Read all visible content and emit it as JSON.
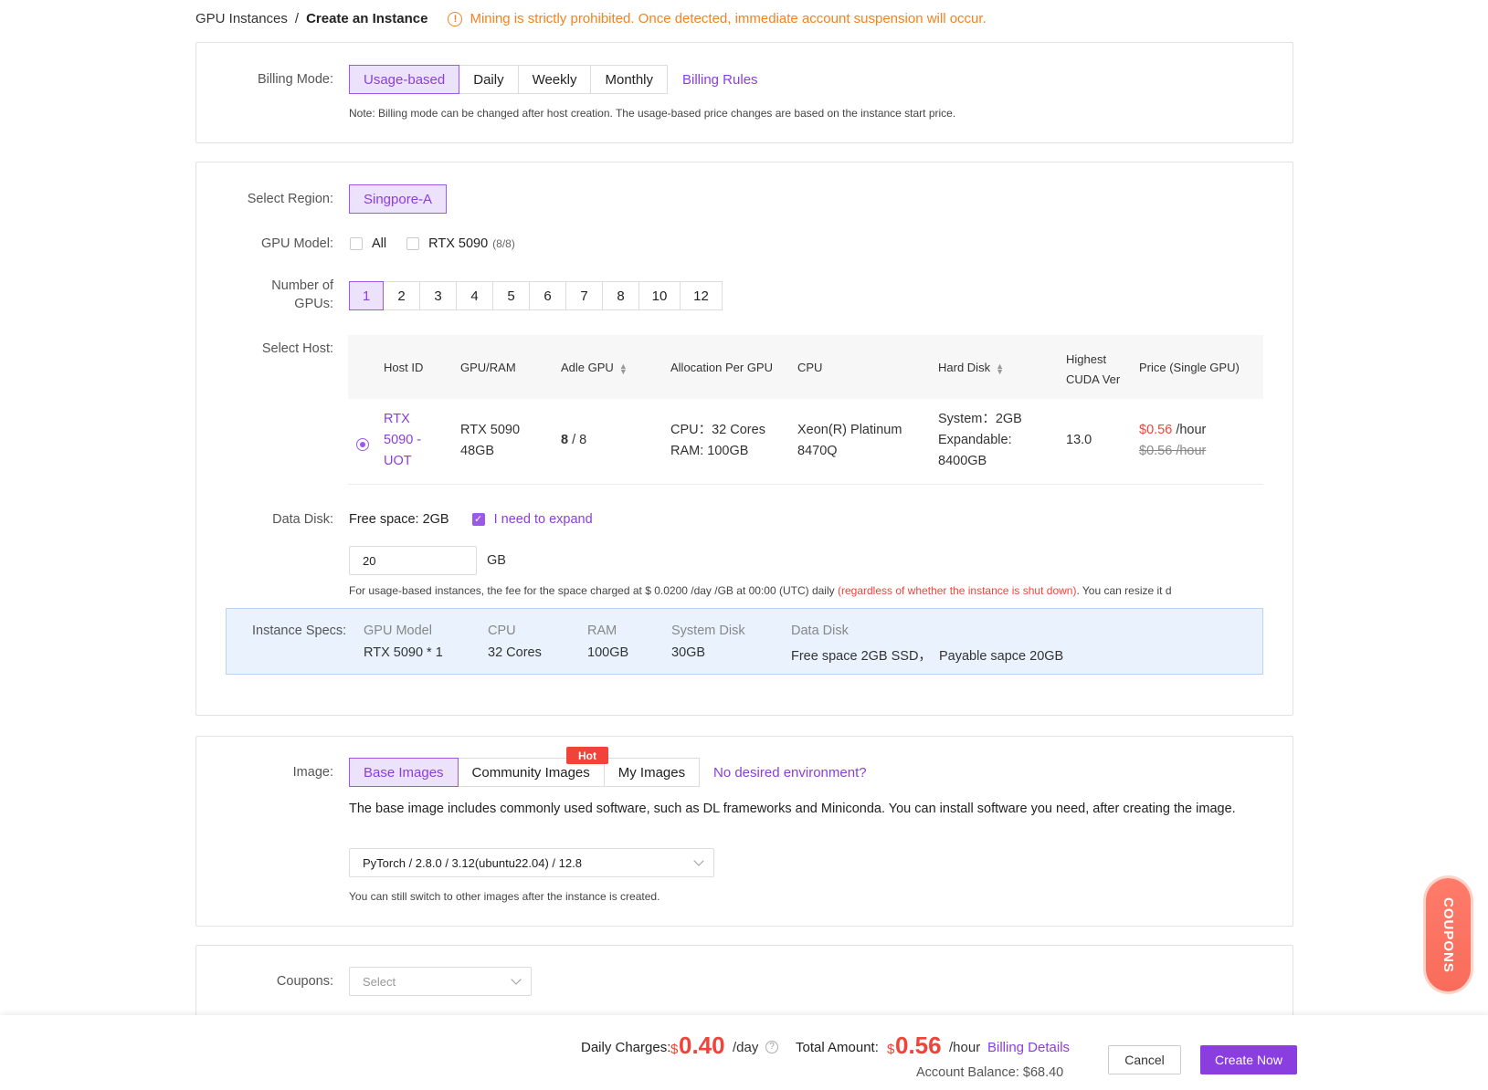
{
  "breadcrumb": {
    "parent": "GPU Instances",
    "separator": "/",
    "current": "Create an Instance"
  },
  "warning": {
    "icon": "info-icon",
    "text": "Mining is strictly prohibited. Once detected, immediate account suspension will occur."
  },
  "billing": {
    "label": "Billing Mode:",
    "options": [
      "Usage-based",
      "Daily",
      "Weekly",
      "Monthly"
    ],
    "selected": "Usage-based",
    "rules_link": "Billing Rules",
    "note": "Note: Billing mode can be changed after host creation. The usage-based price changes are based on the instance start price."
  },
  "region": {
    "label": "Select Region:",
    "selected": "Singpore-A"
  },
  "gpu_model": {
    "label": "GPU Model:",
    "options": [
      {
        "label": "All"
      },
      {
        "label": "RTX 5090",
        "count": "(8/8)"
      }
    ]
  },
  "gpu_count": {
    "label_line1": "Number of",
    "label_line2": "GPUs:",
    "options": [
      "1",
      "2",
      "3",
      "4",
      "5",
      "6",
      "7",
      "8",
      "10",
      "12"
    ],
    "selected": "1"
  },
  "host": {
    "label": "Select Host:",
    "headers": {
      "host_id": "Host ID",
      "gpu_ram": "GPU/RAM",
      "idle_gpu": "Adle GPU",
      "allocation": "Allocation Per GPU",
      "cpu": "CPU",
      "hard_disk": "Hard Disk",
      "cuda_line1": "Highest",
      "cuda_line2": "CUDA Ver",
      "price": "Price (Single GPU)"
    },
    "row": {
      "host_id_l1": "RTX",
      "host_id_l2": "5090 -",
      "host_id_l3": "UOT",
      "gpu_l1": "RTX 5090",
      "gpu_l2": "48GB",
      "idle_avail": "8",
      "idle_total": "/ 8",
      "alloc_l1": "CPU：32 Cores",
      "alloc_l2": "RAM: 100GB",
      "cpu_l1": "Xeon(R) Platinum",
      "cpu_l2": "8470Q",
      "disk_l1": "System：2GB",
      "disk_l2": "Expandable:",
      "disk_l3": "8400GB",
      "cuda": "13.0",
      "price": "$0.56",
      "price_unit": "/hour",
      "price_orig": "$0.56 /hour"
    }
  },
  "data_disk": {
    "label": "Data Disk:",
    "free_space": "Free space: 2GB",
    "expand_label": "I need to expand",
    "expand_checked": true,
    "value": "20",
    "unit": "GB",
    "note_a": "For usage-based instances, the fee for the space charged at $ 0.0200 /day /GB at 00:00 (UTC) daily ",
    "note_red": "(regardless of whether the instance is shut down)",
    "note_b": ". You can resize it d"
  },
  "specs": {
    "label": "Instance Specs:",
    "items": [
      {
        "head": "GPU Model",
        "value": "RTX 5090 * 1"
      },
      {
        "head": "CPU",
        "value": "32 Cores"
      },
      {
        "head": "RAM",
        "value": "100GB"
      },
      {
        "head": "System Disk",
        "value": "30GB"
      },
      {
        "head": "Data Disk",
        "value": "Free space 2GB SSD，  Payable sapce 20GB"
      }
    ]
  },
  "image": {
    "label": "Image:",
    "tabs": [
      "Base Images",
      "Community Images",
      "My Images"
    ],
    "selected": "Base Images",
    "hot_badge": "Hot",
    "help_link": "No desired environment?",
    "desc": "The base image includes commonly used software, such as DL frameworks and Miniconda. You can install software you need, after creating the image.",
    "select_value": "PyTorch / 2.8.0 / 3.12(ubuntu22.04) / 12.8",
    "note": "You can still switch to other images after the instance is created."
  },
  "coupons": {
    "label": "Coupons:",
    "placeholder": "Select",
    "float_label": "COUPONS"
  },
  "footer": {
    "daily_label": "Daily Charges:",
    "daily_currency": "$",
    "daily_value": "0.40",
    "daily_unit": "/day",
    "total_label": "Total Amount:",
    "total_currency": "$",
    "total_value": "0.56",
    "total_unit": "/hour",
    "billing_details": "Billing Details",
    "balance": "Account Balance: $68.40",
    "cancel": "Cancel",
    "create": "Create Now"
  },
  "colors": {
    "accent": "#8a3ee0",
    "accent_bg": "#ede2fb",
    "warning": "#f5821f",
    "price_red": "#f0433a",
    "specs_bg": "#eaf3fd"
  }
}
